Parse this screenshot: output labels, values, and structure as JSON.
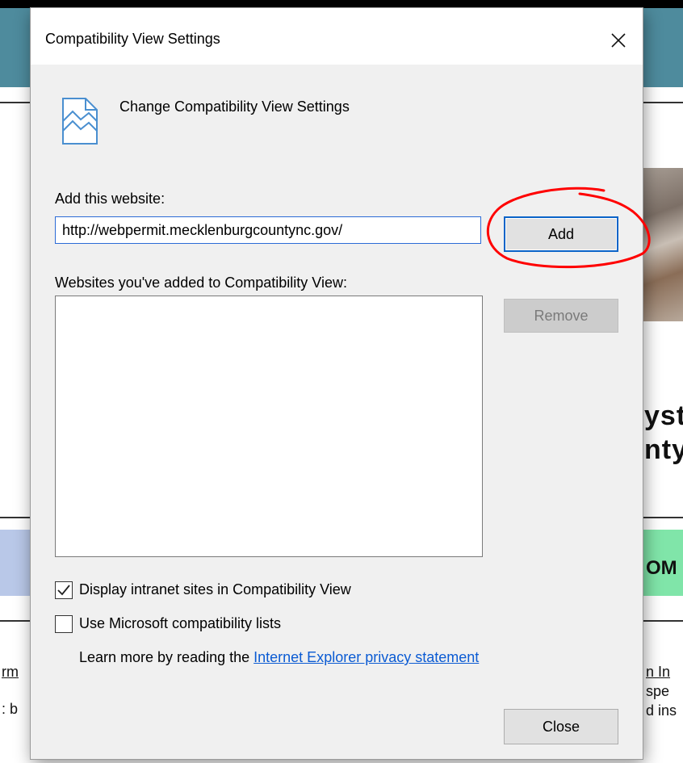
{
  "background": {
    "heading_line1": "yst",
    "heading_line2": "nty",
    "band_text": "OM",
    "left_text1": "rm",
    "left_text2": ": b",
    "right_text1": "n In",
    "right_text2": "spe",
    "right_text3": "d ins"
  },
  "dialog": {
    "title": "Compatibility View Settings",
    "heading": "Change Compatibility View Settings",
    "add_label": "Add this website:",
    "url_value": "http://webpermit.mecklenburgcountync.gov/",
    "add_button": "Add",
    "list_label": "Websites you've added to Compatibility View:",
    "remove_button": "Remove",
    "checkbox_intranet": {
      "label": "Display intranet sites in Compatibility View",
      "checked": true
    },
    "checkbox_ms_lists": {
      "label": "Use Microsoft compatibility lists",
      "checked": false
    },
    "learn_more_prefix": "Learn more by reading the ",
    "learn_more_link": "Internet Explorer privacy statement",
    "close_button": "Close"
  },
  "colors": {
    "annotation_circle": "#ff0000",
    "link": "#0b5bd3",
    "focus_border": "#0a64c8"
  }
}
